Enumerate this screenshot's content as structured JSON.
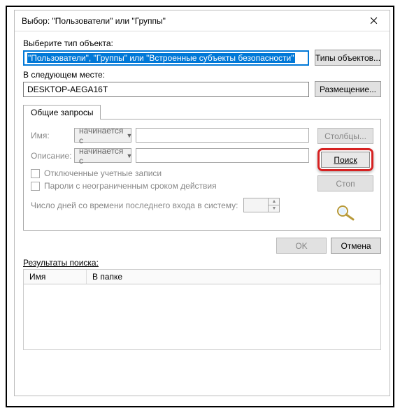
{
  "window": {
    "title": "Выбор: \"Пользователи\" или \"Группы\""
  },
  "labels": {
    "select_object_type": "Выберите тип объекта:",
    "in_location": "В следующем месте:",
    "results": "Результаты поиска:"
  },
  "fields": {
    "object_type_value": "\"Пользователи\", \"Группы\" или \"Встроенные субъекты безопасности\"",
    "location_value": "DESKTOP-AEGA16T"
  },
  "buttons": {
    "object_types": "Типы объектов...",
    "locations": "Размещение...",
    "columns": "Столбцы...",
    "search": "Поиск",
    "stop": "Стоп",
    "ok": "OK",
    "cancel": "Отмена"
  },
  "tab": {
    "title": "Общие запросы",
    "name_label": "Имя:",
    "desc_label": "Описание:",
    "starts_with": "начинается с",
    "chk_disabled": "Отключенные учетные записи",
    "chk_nonexp": "Пароли с неограниченным сроком действия",
    "days_label": "Число дней со времени последнего входа в систему:"
  },
  "grid": {
    "col_name": "Имя",
    "col_folder": "В папке"
  }
}
